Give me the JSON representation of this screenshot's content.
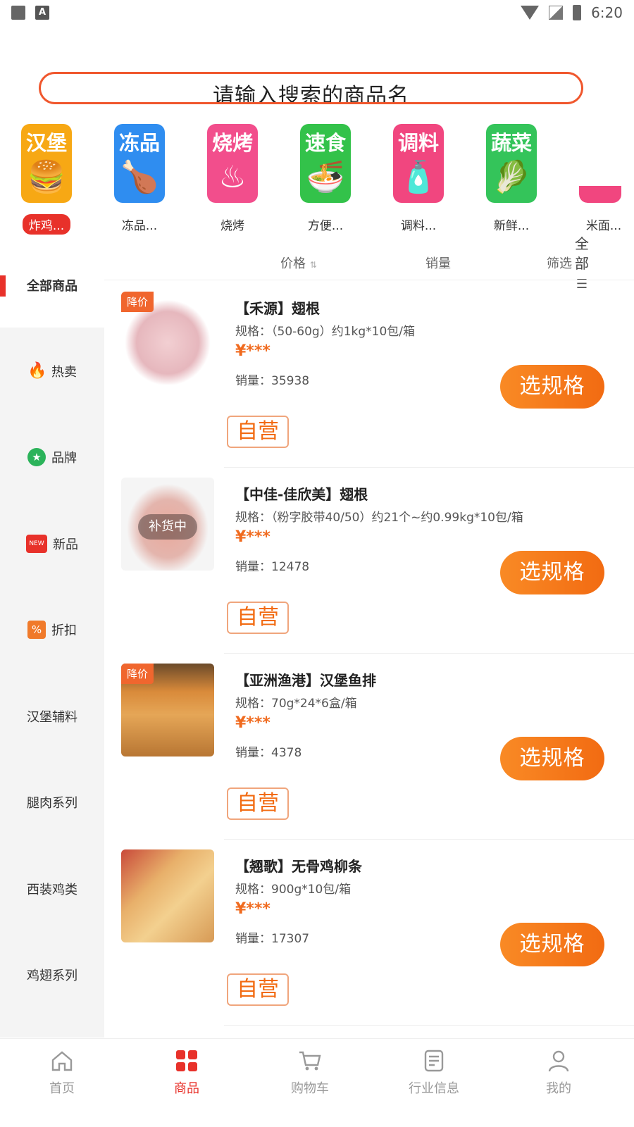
{
  "status_bar": {
    "time": "6:20"
  },
  "search": {
    "placeholder": "请输入搜索的商品名"
  },
  "categories": [
    {
      "title": "汉堡",
      "label": "炸鸡...",
      "color": "#f7a814",
      "icon": "burger-icon"
    },
    {
      "title": "冻品",
      "label": "冻品...",
      "color": "#2f8df0",
      "icon": "drumstick-icon"
    },
    {
      "title": "烧烤",
      "label": "烧烤",
      "color": "#f24e8c",
      "icon": "grill-icon"
    },
    {
      "title": "速食",
      "label": "方便...",
      "color": "#33c24a",
      "icon": "noodle-bowl-icon"
    },
    {
      "title": "调料",
      "label": "调料...",
      "color": "#f1467f",
      "icon": "sauce-bottle-icon"
    },
    {
      "title": "蔬菜",
      "label": "新鲜...",
      "color": "#34c45a",
      "icon": "vegetable-icon"
    },
    {
      "title": "",
      "label": "米面...",
      "color": "#f1467f",
      "icon": "rice-bowl-icon"
    }
  ],
  "all_categories": {
    "line1": "全",
    "line2": "部"
  },
  "sort_bar": {
    "price": "价格",
    "sales": "销量",
    "filter": "筛选"
  },
  "sidebar": [
    {
      "label": "全部商品",
      "icon": ""
    },
    {
      "label": "热卖",
      "icon": "flame-icon"
    },
    {
      "label": "品牌",
      "icon": "award-icon"
    },
    {
      "label": "新品",
      "icon": "new-tag-icon"
    },
    {
      "label": "折扣",
      "icon": "discount-tag-icon"
    },
    {
      "label": "汉堡辅料",
      "icon": ""
    },
    {
      "label": "腿肉系列",
      "icon": ""
    },
    {
      "label": "西装鸡类",
      "icon": ""
    },
    {
      "label": "鸡翅系列",
      "icon": ""
    }
  ],
  "products": [
    {
      "name": "【禾源】翅根",
      "spec": "规格：（50-60g）约1kg*10包/箱",
      "price": "¥***",
      "sold": "销量：35938",
      "badge": "降价",
      "overlay": "",
      "button": "选规格",
      "tag": "自营"
    },
    {
      "name": "【中佳-佳欣美】翅根",
      "spec": "规格：（粉字胶带40/50）约21个~约0.99kg*10包/箱",
      "price": "¥***",
      "sold": "销量：12478",
      "badge": "",
      "overlay": "补货中",
      "button": "选规格",
      "tag": "自营"
    },
    {
      "name": "【亚洲渔港】汉堡鱼排",
      "spec": "规格：70g*24*6盒/箱",
      "price": "¥***",
      "sold": "销量：4378",
      "badge": "降价",
      "overlay": "",
      "button": "选规格",
      "tag": "自营"
    },
    {
      "name": "【翘歌】无骨鸡柳条",
      "spec": "规格：900g*10包/箱",
      "price": "¥***",
      "sold": "销量：17307",
      "badge": "",
      "overlay": "",
      "button": "选规格",
      "tag": "自营"
    }
  ],
  "nav": [
    {
      "label": "首页",
      "icon": "home-icon"
    },
    {
      "label": "商品",
      "icon": "grid-icon"
    },
    {
      "label": "购物车",
      "icon": "cart-icon"
    },
    {
      "label": "行业信息",
      "icon": "document-icon"
    },
    {
      "label": "我的",
      "icon": "user-icon"
    }
  ],
  "colors": {
    "accent": "#e8312a",
    "orange": "#f26b12"
  }
}
